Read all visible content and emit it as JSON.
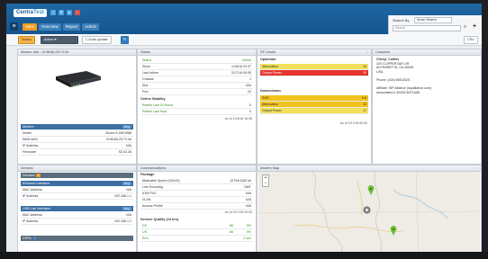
{
  "header": {
    "logo_part1": "Centra",
    "logo_part2": "Test",
    "nav_tabs": [
      "Sites",
      "Overview",
      "Report",
      "Admin"
    ],
    "top_icon_colors": [
      "#4aa3e0",
      "#4aa3e0",
      "#4aa3e0",
      "#d9534f"
    ]
  },
  "search": {
    "label": "Search By",
    "type_value": "Smart Search",
    "placeholder": "Search",
    "search_icon": "search-icon",
    "add_icon": "plus-icon"
  },
  "toolbar": {
    "status_label": "Status",
    "action_label": "Action ▾",
    "autoupdate_label": "Auto update",
    "csv_label": "CSV"
  },
  "modem": {
    "title": "Modem Info - 24:f8:8A:29:71:34",
    "section_label": "Modem",
    "ping_label": "Ping",
    "rows": [
      {
        "k": "Model",
        "v": "Zhone 6-498 W88"
      },
      {
        "k": "WAN MAC",
        "v": "24:f8:8A:29:71:3a"
      },
      {
        "k": "IP Address",
        "v": "N/A"
      },
      {
        "k": "Firmware",
        "v": "S3.02.28"
      }
    ]
  },
  "status": {
    "title": "Status",
    "rows": [
      {
        "k": "Status",
        "v": "Online",
        "green": true
      },
      {
        "k": "Since",
        "v": "1/18/18 22:37"
      },
      {
        "k": "Last Inform",
        "v": "2/17/18 00:00"
      },
      {
        "k": "Chassis",
        "v": "1"
      },
      {
        "k": "Slot",
        "v": "N/A"
      },
      {
        "k": "Port",
        "v": "22"
      }
    ],
    "stability_label": "Online Stability",
    "stability_rows": [
      {
        "k": "Reinits Last 24 Hours",
        "v": "0"
      },
      {
        "k": "Reinits Last Hour",
        "v": "0"
      }
    ],
    "asof": "As of 1/19/18 16:26"
  },
  "levels": {
    "title": "RF Levels",
    "upstream_label": "Upstream",
    "upstream_rows": [
      {
        "k": "Attenuation",
        "v": "25",
        "bg": "#f2e05a"
      },
      {
        "k": "Output Power",
        "v": "10",
        "bg": "#e5342c"
      }
    ],
    "downstream_label": "Downstream",
    "downstream_rows": [
      {
        "k": "SNR",
        "v": "6.8",
        "bg": "#f2c31e"
      },
      {
        "k": "Attenuation",
        "v": "43",
        "bg": "#f2c31e"
      },
      {
        "k": "Output Power",
        "v": "17",
        "bg": "#f2e05a"
      }
    ],
    "asof": "As of 2/17/18 00:00"
  },
  "customer": {
    "title": "Customer",
    "lines": [
      "Cheryl, Collins",
      "320 CLIPPER BAY DR",
      "ALPHARETTA, GA 30005",
      "USA",
      "",
      "Phone: (404) 655-6325",
      "",
      "Affiliate: ISP Alliance (Ispalliance.com)",
      "Associated #: 801DC8471A6E"
    ]
  },
  "devices": {
    "title": "Devices",
    "header_label": "Devices",
    "count": "2",
    "groups": [
      {
        "name": "Ethernet Interface",
        "rows": [
          {
            "k": "MAC Address",
            "v": "N/A"
          },
          {
            "k": "IP Address",
            "v": "192.168.1.1"
          }
        ]
      },
      {
        "name": "USB Lan Interface",
        "rows": [
          {
            "k": "MAC Address",
            "v": "N/A"
          },
          {
            "k": "IP Address",
            "v": "192.168.1.1"
          }
        ]
      }
    ],
    "cpes_label": "CPEs",
    "cpes_count": "0"
  },
  "comms": {
    "title": "Communications",
    "package_label": "Package",
    "rows": [
      {
        "k": "Attainable Speed (DS/US)",
        "v": "12794/1282 kb"
      },
      {
        "k": "Line Encoding",
        "v": "DMT"
      },
      {
        "k": "ATM PVC",
        "v": "N/A"
      },
      {
        "k": "VLAN",
        "v": "N/A"
      },
      {
        "k": "Access Profile",
        "v": "N/A"
      }
    ],
    "asof": "As of 2/17/18 00:00",
    "quality_label": "Service Quality (24 hrs)",
    "quality_rows": [
      {
        "k": "DS",
        "v1": "86",
        "v2": "0%"
      },
      {
        "k": "US",
        "v1": "88",
        "v2": "0%"
      },
      {
        "k": "Errs",
        "v1": "",
        "v2": "0 sec"
      }
    ]
  },
  "map": {
    "title": "Modem Map",
    "zoom_in": "+",
    "zoom_out": "−"
  }
}
